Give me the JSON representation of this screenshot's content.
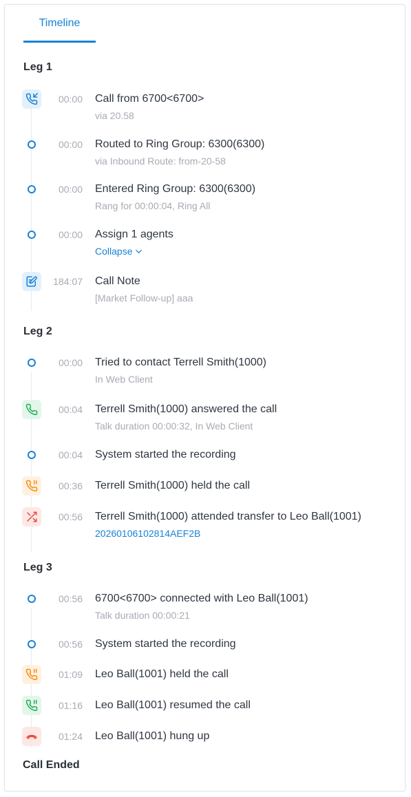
{
  "tabs": {
    "active": "Timeline"
  },
  "legs": [
    {
      "title": "Leg 1"
    },
    {
      "title": "Leg 2"
    },
    {
      "title": "Leg 3"
    }
  ],
  "events": [
    {
      "time": "00:00",
      "title": "Call from 6700<6700>",
      "sub": "via 20.58",
      "icon": "incoming-call-icon"
    },
    {
      "time": "00:00",
      "title": "Routed to Ring Group: 6300(6300)",
      "sub": "via Inbound Route: from-20-58",
      "icon": "dot"
    },
    {
      "time": "00:00",
      "title": "Entered Ring Group: 6300(6300)",
      "sub": "Rang for 00:00:04, Ring All",
      "icon": "dot"
    },
    {
      "time": "00:00",
      "title": "Assign 1 agents",
      "sub": "Collapse",
      "icon": "dot"
    },
    {
      "time": "184:07",
      "title": "Call Note",
      "sub": "[Market Follow-up] aaa",
      "icon": "call-note-icon"
    },
    {
      "time": "00:00",
      "title": "Tried to contact Terrell Smith(1000)",
      "sub": "In Web Client",
      "icon": "dot"
    },
    {
      "time": "00:04",
      "title": "Terrell Smith(1000) answered the call",
      "sub": "Talk duration 00:00:32, In Web Client",
      "icon": "answered-call-icon"
    },
    {
      "time": "00:04",
      "title": "System started the recording",
      "icon": "dot"
    },
    {
      "time": "00:36",
      "title": "Terrell Smith(1000) held the call",
      "icon": "hold-call-icon"
    },
    {
      "time": "00:56",
      "title": "Terrell Smith(1000) attended transfer to Leo Ball(1001)",
      "sub": "20260106102814AEF2B",
      "icon": "transfer-icon"
    },
    {
      "time": "00:56",
      "title": "6700<6700> connected with Leo Ball(1001)",
      "sub": "Talk duration 00:00:21",
      "icon": "dot"
    },
    {
      "time": "00:56",
      "title": "System started the recording",
      "icon": "dot"
    },
    {
      "time": "01:09",
      "title": "Leo Ball(1001) held the call",
      "icon": "hold-call-icon"
    },
    {
      "time": "01:16",
      "title": "Leo Ball(1001) resumed the call",
      "icon": "resume-call-icon"
    },
    {
      "time": "01:24",
      "title": "Leo Ball(1001) hung up",
      "icon": "hang-up-icon"
    }
  ],
  "ended_label": "Call Ended",
  "colors": {
    "accent": "#1682d6",
    "green": "#1fb056",
    "orange": "#f29014",
    "red": "#ea4a3d"
  }
}
